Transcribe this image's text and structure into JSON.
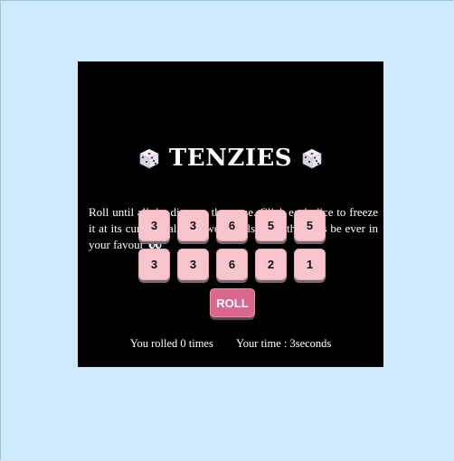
{
  "game": {
    "title": "TENZIES",
    "description": "Roll until all the dice are the same. Click each dice to freeze it at its current value between rolls. May the odds be ever in your favour",
    "dice": [
      "3",
      "3",
      "6",
      "5",
      "5",
      "3",
      "3",
      "6",
      "2",
      "1"
    ],
    "roll_label": "ROLL",
    "rolls_text": "You rolled 0 times",
    "time_text": "Your time : 3seconds"
  },
  "colors": {
    "background": "#cfeafc",
    "board": "#000000",
    "die": "#f8c4cd",
    "roll_button": "#d9688c"
  },
  "icons": {
    "title_left": "dice-icon",
    "title_right": "dice-icon",
    "description_end": "eyes-icon"
  }
}
